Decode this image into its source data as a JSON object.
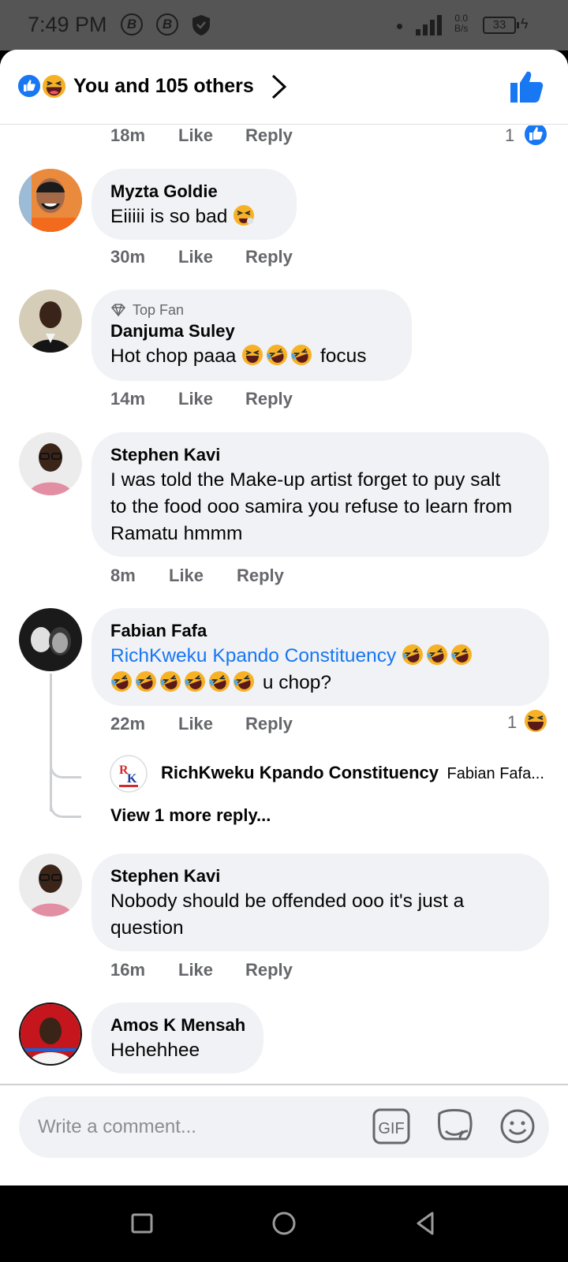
{
  "status_bar": {
    "time": "7:49 PM",
    "icons": [
      "b-coin-icon",
      "b-coin-icon",
      "shield-icon",
      "dot-icon",
      "signal-icon"
    ],
    "net_speed_value": "0.0",
    "net_speed_unit": "B/s",
    "battery": "33"
  },
  "header": {
    "reactions_text": "You and 105 others",
    "reaction_icons": [
      "like-icon",
      "haha-icon"
    ]
  },
  "previous_comment_meta": {
    "time": "18m",
    "like": "Like",
    "reply": "Reply",
    "reaction_count": "1"
  },
  "comments": [
    {
      "name": "Myzta Goldie",
      "text": "Eiiiii is so bad",
      "emoji": [
        "tired-face-emoji"
      ],
      "time": "30m",
      "like": "Like",
      "reply": "Reply"
    },
    {
      "badge": "Top Fan",
      "name": "Danjuma Suley",
      "text_before": "Hot chop paaa",
      "text_after": "focus",
      "emoji": [
        "haha-emoji",
        "rofl-emoji",
        "rofl-emoji"
      ],
      "time": "14m",
      "like": "Like",
      "reply": "Reply"
    },
    {
      "name": "Stephen Kavi",
      "text": "I was told the Make-up artist forget to puy salt to the food ooo samira you refuse to learn from Ramatu hmmm",
      "time": "8m",
      "like": "Like",
      "reply": "Reply"
    },
    {
      "name": "Fabian Fafa",
      "mention": "RichKweku Kpando Constituency",
      "text_after": "u chop?",
      "emoji": [
        "rofl-emoji",
        "rofl-emoji",
        "rofl-emoji",
        "rofl-emoji",
        "rofl-emoji",
        "rofl-emoji",
        "rofl-emoji",
        "rofl-emoji",
        "rofl-emoji"
      ],
      "time": "22m",
      "like": "Like",
      "reply": "Reply",
      "reaction_count": "1",
      "reply_preview": {
        "name": "RichKweku Kpando Constituency",
        "snippet": "Fabian Fafa..."
      },
      "view_more": "View 1 more reply..."
    },
    {
      "name": "Stephen Kavi",
      "text": "Nobody should be offended ooo it's just a question",
      "time": "16m",
      "like": "Like",
      "reply": "Reply"
    },
    {
      "name": "Amos K Mensah",
      "text": "Hehehhee"
    }
  ],
  "composer": {
    "placeholder": "Write a comment...",
    "gif_label": "GIF"
  },
  "colors": {
    "accent": "#1877f2",
    "bubble": "#f0f2f5",
    "meta": "#65676b",
    "status_bar": "#555555"
  }
}
